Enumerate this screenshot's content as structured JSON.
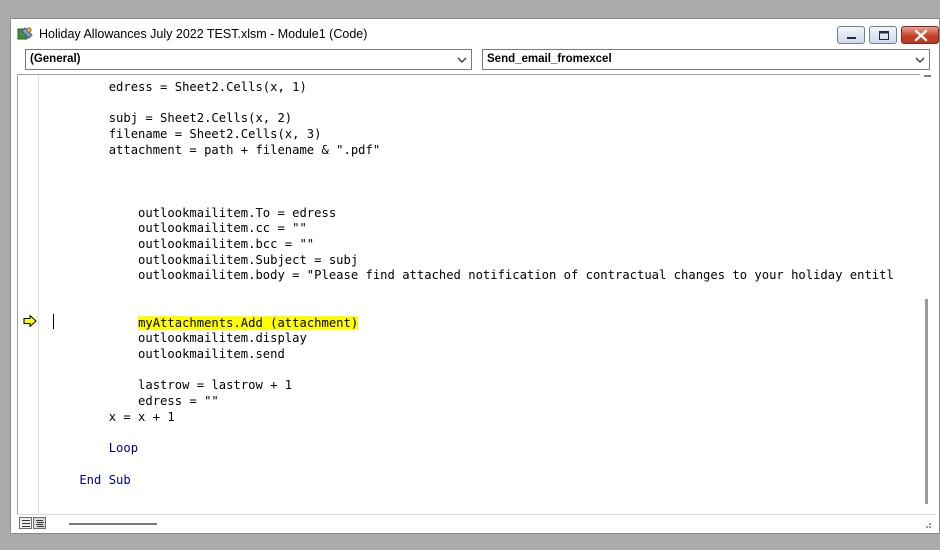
{
  "window": {
    "title": "Holiday Allowances July 2022 TEST.xlsm - Module1 (Code)",
    "icon": "vba-editor-icon"
  },
  "controls": {
    "minimize": "minimize-icon",
    "maximize": "maximize-icon",
    "close": "close-icon"
  },
  "object_combo": {
    "value": "(General)"
  },
  "procedure_combo": {
    "value": "Send_email_fromexcel"
  },
  "code": {
    "lines": [
      "        edress = Sheet2.Cells(x, 1)",
      "",
      "        subj = Sheet2.Cells(x, 2)",
      "        filename = Sheet2.Cells(x, 3)",
      "        attachment = path + filename & \".pdf\"",
      "",
      "",
      "",
      "            outlookmailitem.To = edress",
      "            outlookmailitem.cc = \"\"",
      "            outlookmailitem.bcc = \"\"",
      "            outlookmailitem.Subject = subj",
      "            outlookmailitem.body = \"Please find attached notification of contractual changes to your holiday entitl",
      "",
      "",
      "            myAttachments.Add (attachment)",
      "            outlookmailitem.display",
      "            outlookmailitem.send",
      "",
      "            lastrow = lastrow + 1",
      "            edress = \"\"",
      "        x = x + 1",
      "",
      "        Loop",
      "",
      "    End Sub"
    ],
    "keyword_lines": [
      23,
      25
    ],
    "highlighted_line": 15,
    "highlight_color": "#ffff00",
    "keyword_color": "#00008b",
    "execution_arrow_icon": "execution-pointer-icon"
  },
  "colors": {
    "background": "#ababab",
    "window": "#ffffff",
    "close_button": "#c6432b"
  }
}
